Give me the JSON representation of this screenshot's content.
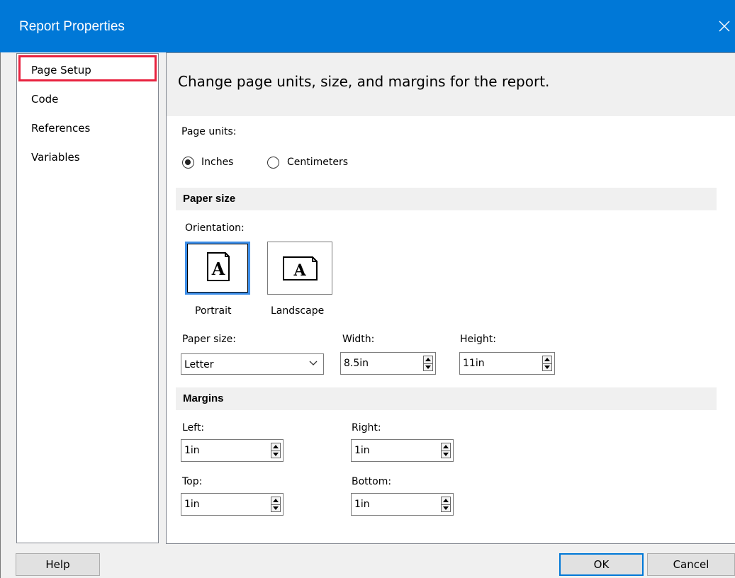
{
  "window": {
    "title": "Report Properties"
  },
  "nav": {
    "items": [
      {
        "label": "Page Setup"
      },
      {
        "label": "Code"
      },
      {
        "label": "References"
      },
      {
        "label": "Variables"
      }
    ]
  },
  "header": {
    "text": "Change page units, size, and margins for the report."
  },
  "page_units": {
    "label": "Page units:",
    "options": [
      "Inches",
      "Centimeters"
    ],
    "selected": "Inches"
  },
  "paper_size_section": {
    "title": "Paper size",
    "orientation_label": "Orientation:",
    "portrait_label": "Portrait",
    "landscape_label": "Landscape",
    "selected_orientation": "Portrait",
    "paper_size_label": "Paper size:",
    "paper_size_value": "Letter",
    "width_label": "Width:",
    "width_value": "8.5in",
    "height_label": "Height:",
    "height_value": "11in"
  },
  "margins": {
    "title": "Margins",
    "left_label": "Left:",
    "left_value": "1in",
    "right_label": "Right:",
    "right_value": "1in",
    "top_label": "Top:",
    "top_value": "1in",
    "bottom_label": "Bottom:",
    "bottom_value": "1in"
  },
  "footer": {
    "help": "Help",
    "ok": "OK",
    "cancel": "Cancel"
  },
  "colors": {
    "titlebar": "#0078d7",
    "selection_outline": "#e8223f",
    "focus_blue": "#3d8ee8"
  }
}
